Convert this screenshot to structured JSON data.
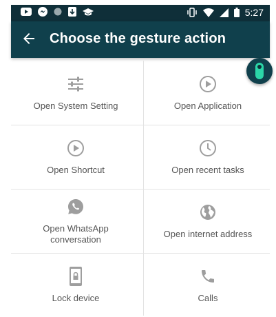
{
  "status_bar": {
    "time": "5:27",
    "left_icons": [
      "youtube-icon",
      "messenger-icon",
      "dot-icon",
      "download-icon",
      "graduation-cap-icon"
    ],
    "right_icons": [
      "vibrate-icon",
      "wifi-icon",
      "signal-icon",
      "battery-icon"
    ]
  },
  "app_bar": {
    "title": "Choose the gesture action",
    "back_icon": "back-arrow-icon"
  },
  "actions": [
    {
      "label": "Open System Setting",
      "icon": "sliders-icon"
    },
    {
      "label": "Open Application",
      "icon": "play-circle-icon"
    },
    {
      "label": "Open Shortcut",
      "icon": "play-circle-icon"
    },
    {
      "label": "Open recent tasks",
      "icon": "clock-icon"
    },
    {
      "label": "Open WhatsApp\nconversation",
      "icon": "whatsapp-icon"
    },
    {
      "label": "Open internet address",
      "icon": "globe-icon"
    },
    {
      "label": "Lock device",
      "icon": "lock-device-icon"
    },
    {
      "label": "Calls",
      "icon": "phone-icon"
    }
  ],
  "colors": {
    "status_bar": "#0f2f39",
    "app_bar": "#10404c",
    "accent": "#2bd6a8",
    "icon": "#9e9e9e",
    "text": "#555555"
  }
}
